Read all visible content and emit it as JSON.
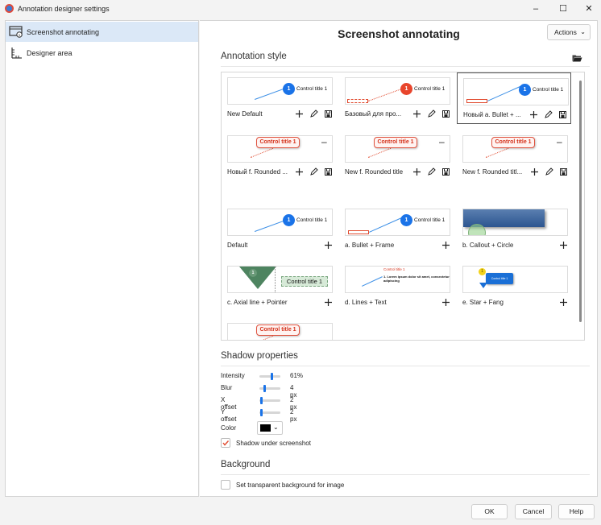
{
  "window": {
    "title": "Annotation designer settings",
    "min_icon": "minimize-icon",
    "max_icon": "maximize-icon",
    "close_icon": "close-icon"
  },
  "sidebar": {
    "items": [
      {
        "label": "Screenshot annotating",
        "icon": "screenshot-annotating-icon",
        "selected": true
      },
      {
        "label": "Designer area",
        "icon": "designer-area-icon",
        "selected": false
      }
    ]
  },
  "main": {
    "title": "Screenshot annotating",
    "actions_label": "Actions"
  },
  "annotation_style": {
    "section_title": "Annotation style",
    "cards": [
      {
        "name": "New Default",
        "preview_label": "Control title 1",
        "preview_badge": "1",
        "tools": [
          "add-icon",
          "edit-icon",
          "save-icon"
        ]
      },
      {
        "name": "Базовый для про...",
        "preview_label": "Control title 1",
        "preview_badge": "1",
        "tools": [
          "add-icon",
          "edit-icon",
          "save-icon"
        ]
      },
      {
        "name": "Новый a. Bullet + ...",
        "preview_label": "Control title 1",
        "preview_badge": "1",
        "tools": [
          "add-icon",
          "edit-icon",
          "save-icon"
        ]
      },
      {
        "name": "Новый f. Rounded ...",
        "preview_label": "Control title 1",
        "tools": [
          "add-icon",
          "edit-icon",
          "save-icon"
        ]
      },
      {
        "name": "New f. Rounded title",
        "preview_label": "Control title 1",
        "tools": [
          "add-icon",
          "edit-icon",
          "save-icon"
        ]
      },
      {
        "name": "New f. Rounded titl...",
        "preview_label": "Control title 1",
        "tools": [
          "add-icon",
          "edit-icon",
          "save-icon"
        ]
      },
      {
        "name": "Default",
        "preview_label": "Control title 1",
        "preview_badge": "1",
        "tools": [
          "add-icon"
        ]
      },
      {
        "name": "a. Bullet + Frame",
        "preview_label": "Control title 1",
        "preview_badge": "1",
        "tools": [
          "add-icon"
        ]
      },
      {
        "name": "b. Callout + Circle",
        "tools": [
          "add-icon"
        ]
      },
      {
        "name": "c. Axial line + Pointer",
        "preview_label": "Control title 1",
        "preview_badge": "1",
        "tools": [
          "add-icon"
        ]
      },
      {
        "name": "d. Lines + Text",
        "preview_label": "Control title 1",
        "preview_text": "1. Lorem ipsum dolor sit amet, consectetur adipiscing",
        "tools": [
          "add-icon"
        ]
      },
      {
        "name": "e. Star + Fang",
        "preview_label": "Control title 1",
        "preview_badge": "1",
        "tools": [
          "add-icon"
        ]
      },
      {
        "name": "",
        "preview_label": "Control title 1",
        "tools": []
      }
    ]
  },
  "shadow": {
    "section_title": "Shadow properties",
    "intensity": {
      "label": "Intensity",
      "value": "61%",
      "level": 0.61
    },
    "blur": {
      "label": "Blur",
      "value": "4 px",
      "level": 0.2
    },
    "x_offset": {
      "label": "X offset",
      "value": "2 px",
      "level": 0.05
    },
    "y_offset": {
      "label": "Y offset",
      "value": "2 px",
      "level": 0.05
    },
    "color": {
      "label": "Color",
      "value": "#000000"
    },
    "shadow_under": {
      "label": "Shadow under screenshot",
      "checked": true
    }
  },
  "background": {
    "section_title": "Background",
    "transparent": {
      "label": "Set transparent background for image",
      "checked": false
    }
  },
  "footer": {
    "ok": "OK",
    "cancel": "Cancel",
    "help": "Help"
  },
  "colors": {
    "accent": "#1a73e8",
    "red": "#e14a2e",
    "selection": "#dbe8f7"
  }
}
